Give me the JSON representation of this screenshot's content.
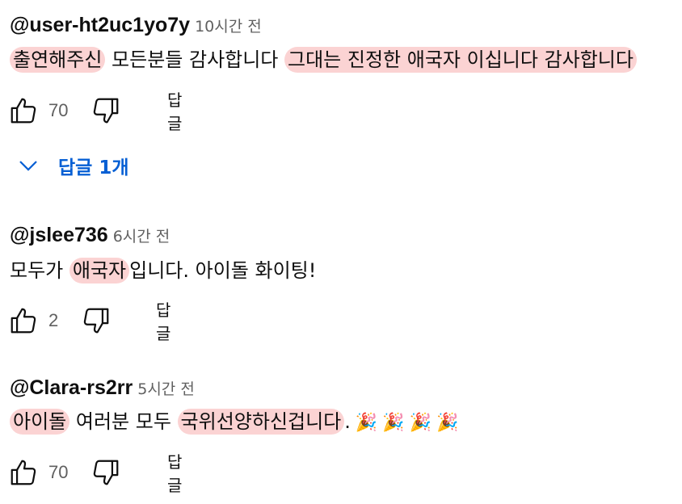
{
  "comments": [
    {
      "author": "@user-ht2uc1yo7y",
      "time": "10시간 전",
      "segments": [
        "출연해주신",
        " 모든분들 감사합니다 ",
        "그대는 진정한 애국자 이십니다 감사합니다"
      ],
      "likes": "70",
      "reply_label": "답글",
      "replies_label": "답글 1개"
    },
    {
      "author": "@jslee736",
      "time": "6시간 전",
      "segments": [
        "모두가 ",
        "애국자",
        "입니다. 아이돌 화이팅!"
      ],
      "likes": "2",
      "reply_label": "답글"
    },
    {
      "author": "@Clara-rs2rr",
      "time": "5시간 전",
      "segments": [
        "아이돌",
        " 여러분 모두 ",
        "국위선양하신겁니다",
        "."
      ],
      "emojis": [
        "🎉",
        "🎉",
        "🎉",
        "🎉"
      ],
      "likes": "70",
      "reply_label": "답글"
    }
  ],
  "colors": {
    "highlight": "#fbd3d3",
    "link": "#065fd4",
    "muted": "#606060"
  },
  "icons": {
    "like": "thumbs-up-icon",
    "dislike": "thumbs-down-icon",
    "expand": "chevron-down-icon"
  }
}
